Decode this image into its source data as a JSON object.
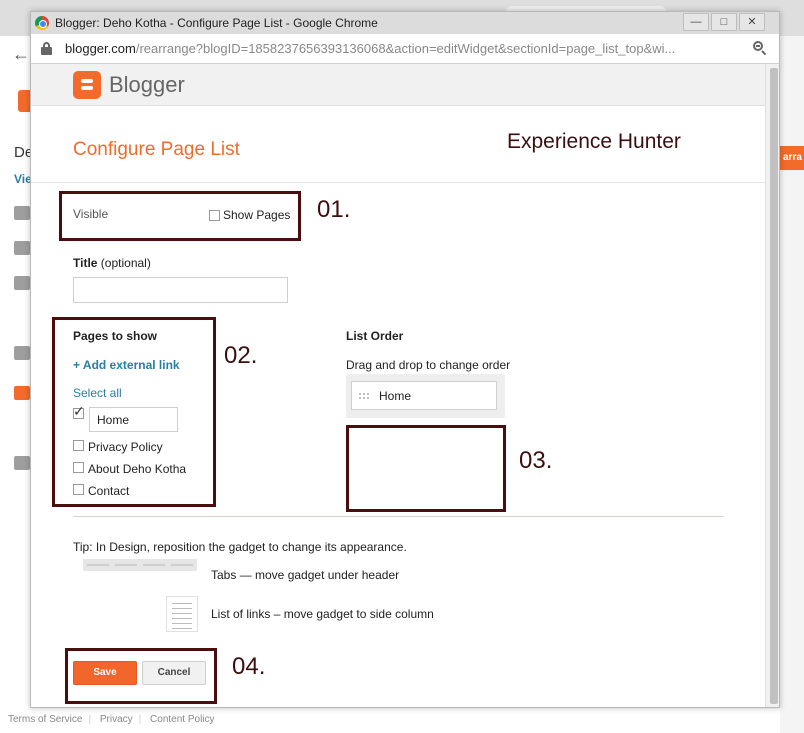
{
  "background": {
    "left_title": "De",
    "left_link": "Vie",
    "right_button": "arra",
    "footer_links": [
      "Terms of Service",
      "Privacy",
      "Content Policy"
    ]
  },
  "window": {
    "title": "Blogger: Deho Kotha - Configure Page List - Google Chrome",
    "url_host": "blogger.com",
    "url_path": "/rearrange?blogID=1858237656393136068&action=editWidget&sectionId=page_list_top&wi..."
  },
  "header": {
    "brand": "Blogger"
  },
  "page": {
    "title": "Configure Page List",
    "watermark": "Experience Hunter"
  },
  "visible": {
    "label": "Visible",
    "show_pages_label": "Show Pages",
    "show_pages_checked": false
  },
  "title_field": {
    "label": "Title",
    "optional": "(optional)",
    "value": ""
  },
  "pages_to_show": {
    "heading": "Pages to show",
    "add_link": "+ Add external link",
    "select_all": "Select all",
    "items": [
      {
        "label": "Home",
        "checked": true
      },
      {
        "label": "Privacy Policy",
        "checked": false
      },
      {
        "label": "About Deho Kotha",
        "checked": false
      },
      {
        "label": "Contact",
        "checked": false
      }
    ]
  },
  "list_order": {
    "heading": "List Order",
    "hint": "Drag and drop to change order",
    "items": [
      "Home"
    ]
  },
  "tip": {
    "text": "Tip: In Design, reposition the gadget to change its appearance.",
    "tabs_text": "Tabs — move gadget under header",
    "links_text": "List of links – move gadget to side column"
  },
  "buttons": {
    "save": "Save",
    "cancel": "Cancel"
  },
  "annotations": [
    "01.",
    "02.",
    "03.",
    "04."
  ],
  "colors": {
    "accent": "#f26b2b",
    "link": "#2a7fa0",
    "annotation": "#4a0e0e"
  }
}
